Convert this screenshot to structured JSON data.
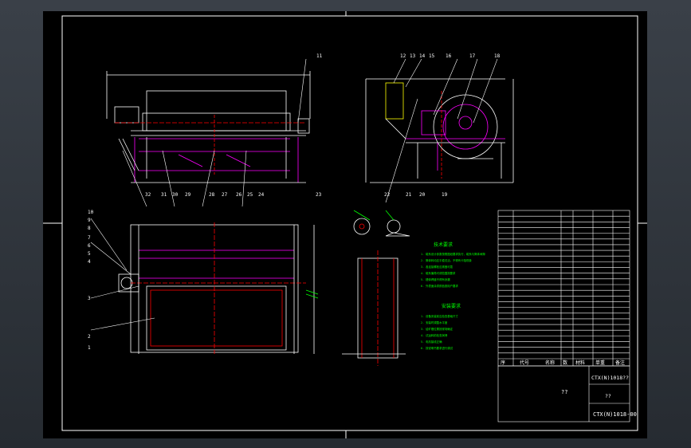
{
  "drawing": {
    "sheet_title": "??",
    "drawing_no": "CTX(N)1018-00",
    "drawing_no_top": "CTX(N)1018??",
    "material": "??",
    "header_labels": [
      "序",
      "代号",
      "名称",
      "数",
      "材料",
      "单重",
      "备注"
    ],
    "balloons_top": [
      "11",
      "12",
      "13",
      "14",
      "15",
      "16",
      "17",
      "18"
    ],
    "balloons_bottom": [
      "32",
      "31",
      "30",
      "29",
      "28",
      "27",
      "26",
      "25",
      "24",
      "23",
      "22",
      "21",
      "20",
      "19"
    ],
    "balloons_left": [
      "10",
      "9",
      "8",
      "7",
      "6",
      "5",
      "4",
      "3",
      "2",
      "1"
    ],
    "note_title_1": "技术要求",
    "note_title_2": "安装要求",
    "notes_1": [
      "1. 磁系设计参数按照图纸要求执行，磁系与筒体间隙",
      "2. 筒体转动应平稳灵活，不得有卡阻现象",
      "3. 各连接螺栓应紧固可靠",
      "4. 磁系偏角可调范围按要求",
      "5. 槽体焊缝不得有渗漏",
      "6. 外表面涂漆颜色按用户要求"
    ],
    "notes_2": [
      "1. 设备安装前应检查基础尺寸",
      "2. 安装时调整水平度",
      "3. 给矿槽位置按现场确定",
      "4. 试运转前检查润滑",
      "5. 电机接线正确",
      "6. 按说明书要求进行调试"
    ],
    "table_rows": 26
  }
}
